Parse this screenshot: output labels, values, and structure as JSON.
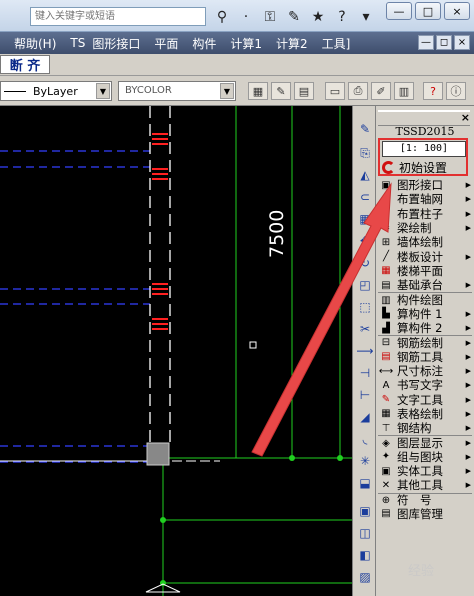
{
  "search": {
    "placeholder": "键入关键字或短语"
  },
  "window_controls": [
    "—",
    "□",
    "×"
  ],
  "menubar": {
    "items": [
      "帮助(H)",
      "TS",
      "图形接口",
      "平面",
      "构件",
      "计算1",
      "计算2",
      "工具]"
    ],
    "controls": [
      "—",
      "◻",
      "×"
    ]
  },
  "strip": {
    "tool_label": "断 齐"
  },
  "properties": {
    "layer_value": "ByLayer",
    "color_value": "BYCOLOR"
  },
  "canvas": {
    "dimension_label": "7500"
  },
  "panel": {
    "title": "TSSD2015",
    "scale": "[1: 100]",
    "init_label": "初始设置",
    "items": [
      {
        "label": "图形接口",
        "arrow": true
      },
      {
        "label": "布置轴网",
        "arrow": true
      },
      {
        "label": "布置柱子",
        "arrow": true
      },
      {
        "label": "梁绘制",
        "arrow": true
      },
      {
        "label": "墙体绘制",
        "arrow": false
      },
      {
        "label": "楼板设计",
        "arrow": true
      },
      {
        "label": "楼梯平面",
        "arrow": false
      },
      {
        "label": "基础承台",
        "arrow": true
      },
      {
        "label": "构件绘图",
        "arrow": false
      },
      {
        "label": "算构件 1",
        "arrow": true
      },
      {
        "label": "算构件 2",
        "arrow": true
      },
      {
        "label": "钢筋绘制",
        "arrow": true
      },
      {
        "label": "钢筋工具",
        "arrow": true
      },
      {
        "label": "尺寸标注",
        "arrow": true
      },
      {
        "label": "书写文字",
        "arrow": true
      },
      {
        "label": "文字工具",
        "arrow": true
      },
      {
        "label": "表格绘制",
        "arrow": true
      },
      {
        "label": "钢结构",
        "arrow": true
      },
      {
        "label": "图层显示",
        "arrow": true
      },
      {
        "label": "组与图块",
        "arrow": true
      },
      {
        "label": "实体工具",
        "arrow": true
      },
      {
        "label": "其他工具",
        "arrow": true
      },
      {
        "label": "符　号",
        "arrow": false
      },
      {
        "label": "图库管理",
        "arrow": false
      }
    ]
  },
  "watermark": "经验"
}
